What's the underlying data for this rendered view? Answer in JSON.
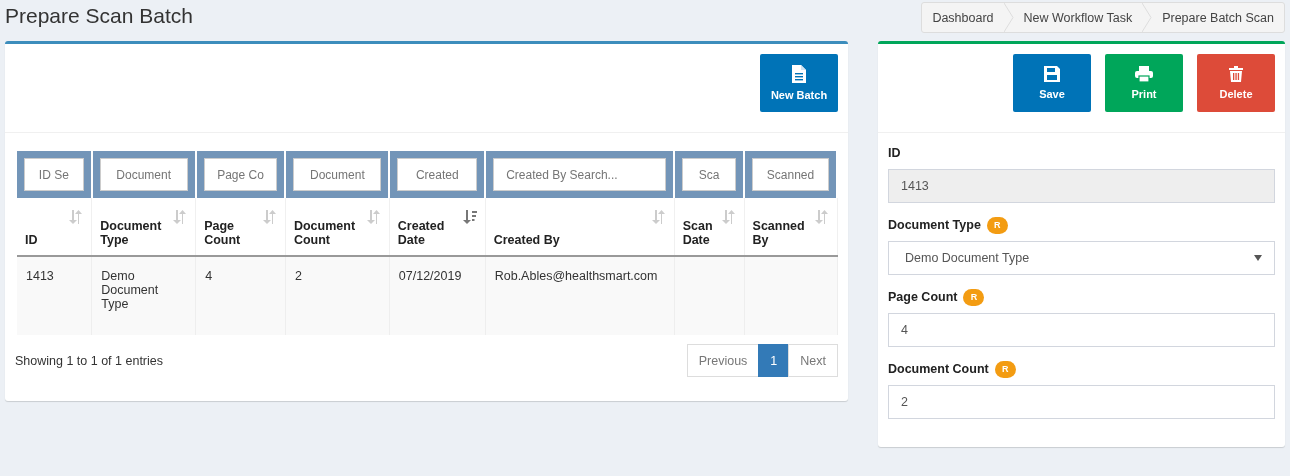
{
  "page_title": "Prepare Scan Batch",
  "breadcrumb": [
    {
      "label": "Dashboard"
    },
    {
      "label": "New Workflow Task"
    },
    {
      "label": "Prepare Batch Scan"
    }
  ],
  "batch_panel": {
    "new_button": "New Batch",
    "table": {
      "search_placeholders": [
        "ID Se",
        "Document",
        "Page Co",
        "Document",
        "Created",
        "Created By Search...",
        "Sca",
        "Scanned"
      ],
      "columns": [
        {
          "label": "ID",
          "sorted": false
        },
        {
          "label": "Document Type",
          "sorted": false
        },
        {
          "label": "Page Count",
          "sorted": false
        },
        {
          "label": "Document Count",
          "sorted": false
        },
        {
          "label": "Created Date",
          "sorted": true
        },
        {
          "label": "Created By",
          "sorted": false
        },
        {
          "label": "Scan Date",
          "sorted": false
        },
        {
          "label": "Scanned By",
          "sorted": false
        }
      ],
      "rows": [
        [
          "1413",
          "Demo Document Type",
          "4",
          "2",
          "07/12/2019",
          "Rob.Ables@healthsmart.com",
          "",
          ""
        ]
      ]
    },
    "info": "Showing 1 to 1 of 1 entries",
    "pagination": [
      {
        "label": "Previous",
        "selected": false
      },
      {
        "label": "1",
        "selected": true
      },
      {
        "label": "Next",
        "selected": false
      }
    ]
  },
  "detail_panel": {
    "buttons": [
      {
        "kind": "save",
        "label": "Save"
      },
      {
        "kind": "print",
        "label": "Print"
      },
      {
        "kind": "delete",
        "label": "Delete"
      }
    ],
    "fields": [
      {
        "kind": "readonly",
        "label": "ID",
        "value": "1413"
      },
      {
        "kind": "select",
        "label": "Document Type",
        "badge": "R",
        "value": "Demo Document Type"
      },
      {
        "kind": "input",
        "label": "Page Count",
        "badge": "R",
        "value": "4"
      },
      {
        "kind": "input",
        "label": "Document Count",
        "badge": "R",
        "value": "2"
      }
    ]
  }
}
